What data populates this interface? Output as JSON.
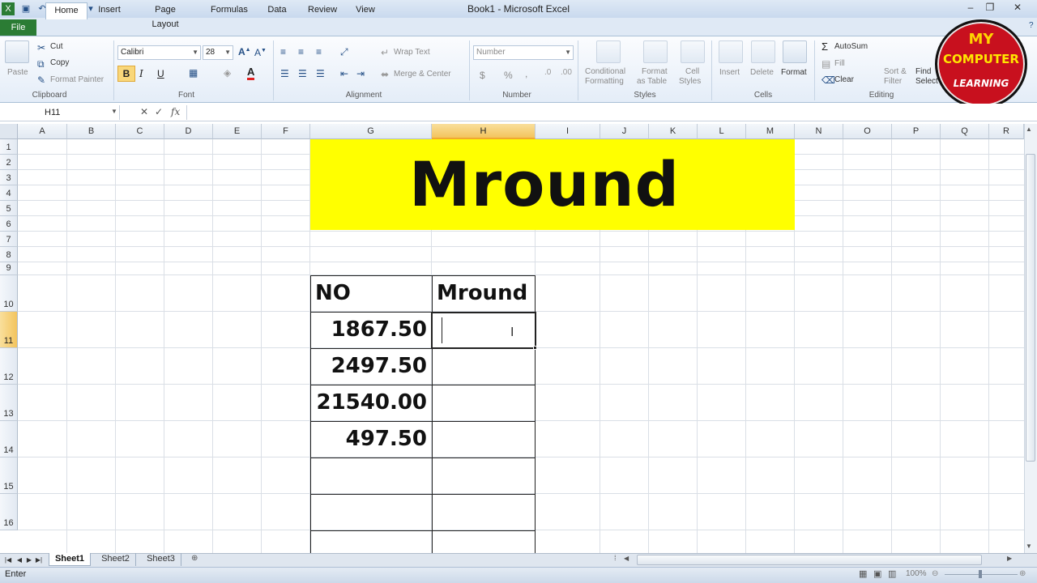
{
  "window": {
    "title": "Book1  -  Microsoft Excel"
  },
  "tabs": [
    "File",
    "Home",
    "Insert",
    "Page Layout",
    "Formulas",
    "Data",
    "Review",
    "View"
  ],
  "ribbon": {
    "clipboard": {
      "paste": "Paste",
      "cut": "Cut",
      "copy": "Copy",
      "format_painter": "Format Painter",
      "label": "Clipboard"
    },
    "font": {
      "name": "Calibri",
      "size": "28",
      "bold": "B",
      "italic": "I",
      "underline": "U",
      "label": "Font"
    },
    "alignment": {
      "wrap_text": "Wrap Text",
      "merge_center": "Merge & Center",
      "label": "Alignment"
    },
    "number": {
      "format": "Number",
      "currency": "$",
      "percent": "%",
      "comma": ",",
      "label": "Number"
    },
    "styles": {
      "conditional": "Conditional",
      "conditional2": "Formatting",
      "format_as": "Format",
      "format_as2": "as Table",
      "cell": "Cell",
      "cell2": "Styles",
      "label": "Styles"
    },
    "cells": {
      "insert": "Insert",
      "delete": "Delete",
      "format": "Format",
      "label": "Cells"
    },
    "editing": {
      "autosum": "AutoSum",
      "fill": "Fill",
      "clear": "Clear",
      "sort": "Sort &",
      "sort2": "Filter",
      "find": "Find",
      "find2": "Select",
      "label": "Editing"
    }
  },
  "formula_bar": {
    "name_box": "H11",
    "fx": "fx",
    "formula": ""
  },
  "columns": [
    "A",
    "B",
    "C",
    "D",
    "E",
    "F",
    "G",
    "H",
    "I",
    "J",
    "K",
    "L",
    "M",
    "N",
    "O",
    "P",
    "Q",
    "R"
  ],
  "rows": [
    "1",
    "2",
    "3",
    "4",
    "5",
    "6",
    "7",
    "8",
    "9",
    "10",
    "11",
    "12",
    "13",
    "14",
    "15",
    "16"
  ],
  "active_cell": {
    "column": "H",
    "row": "11"
  },
  "sheet": {
    "title": "Mround",
    "table": {
      "headers": [
        "NO",
        "Mround"
      ],
      "values": [
        "1867.50",
        "2497.50",
        "21540.00",
        "497.50"
      ]
    }
  },
  "sheet_tabs": [
    "Sheet1",
    "Sheet2",
    "Sheet3"
  ],
  "active_sheet": "Sheet1",
  "status": {
    "mode": "Enter",
    "zoom": "100%"
  },
  "logo": {
    "line1": "MY",
    "line2": "COMPUTER",
    "line3": "LEARNING"
  },
  "colors": {
    "banner": "#ffff00",
    "file_tab": "#2b7c34",
    "active_header": "#f3c45d",
    "logo_red": "#c8101e"
  }
}
